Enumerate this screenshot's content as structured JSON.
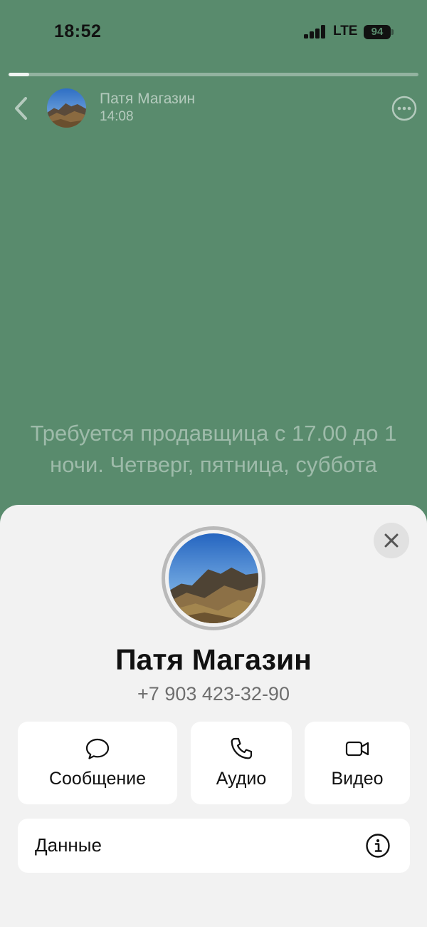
{
  "status_bar": {
    "time": "18:52",
    "network": "LTE",
    "battery": "94"
  },
  "story": {
    "progress": 0.05,
    "author_name": "Патя Магазин",
    "posted_time": "14:08",
    "text": "Требуется продавщица с 17.00 до 1 ночи. Четверг, пятница, суббота",
    "background_color": "#598b6d"
  },
  "contact_sheet": {
    "name": "Патя Магазин",
    "phone": "+7 903 423-32-90",
    "actions": [
      {
        "label": "Сообщение",
        "icon": "chat-bubble-icon"
      },
      {
        "label": "Аудио",
        "icon": "phone-icon"
      },
      {
        "label": "Видео",
        "icon": "video-camera-icon"
      }
    ],
    "details_label": "Данные",
    "details_icon": "info-icon",
    "close_icon": "close-icon"
  }
}
